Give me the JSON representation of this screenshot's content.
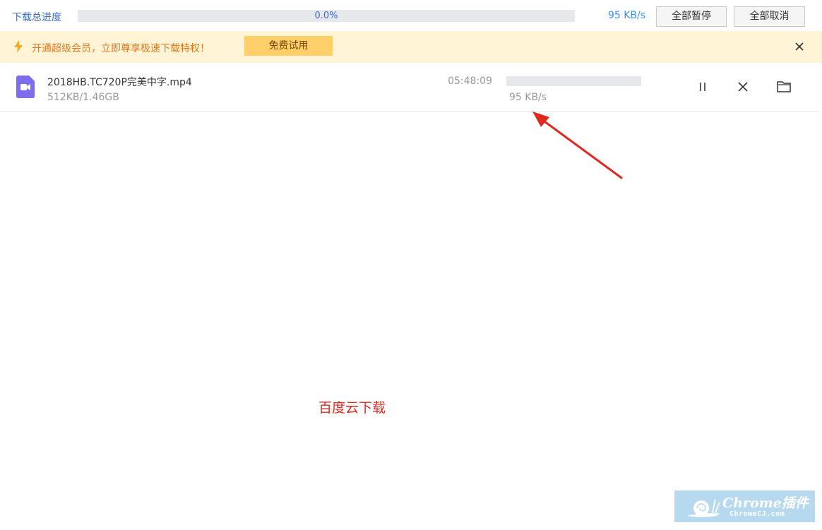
{
  "topbar": {
    "label": "下载总进度",
    "progress_text": "0.0%",
    "progress_fraction": 0.0,
    "speed": "95 KB/s",
    "pause_all_label": "全部暂停",
    "cancel_all_label": "全部取消"
  },
  "banner": {
    "icon": "lightning-icon",
    "text": "开通超级会员，立即尊享极速下载特权！",
    "trial_label": "免费试用",
    "close_icon": "close-icon"
  },
  "downloads": [
    {
      "icon": "video-file-icon",
      "name": "2018HB.TC720P完美中字.mp4",
      "size": "512KB/1.46GB",
      "eta": "05:48:09",
      "progress_fraction": 0.0,
      "speed": "95 KB/s",
      "actions": [
        "pause-icon",
        "cancel-icon",
        "folder-icon"
      ]
    }
  ],
  "annotation": {
    "caption": "百度云下载",
    "arrow_color": "#e0281f"
  },
  "watermark": {
    "title": "Chrome插件",
    "subtitle": "ChromeCJ.com"
  },
  "colors": {
    "accent": "#3b8cff",
    "banner_bg": "#fff4d6",
    "banner_text": "#e07a1f",
    "trial_button": "#ffcf6a",
    "annotation_red": "#e0281f"
  }
}
